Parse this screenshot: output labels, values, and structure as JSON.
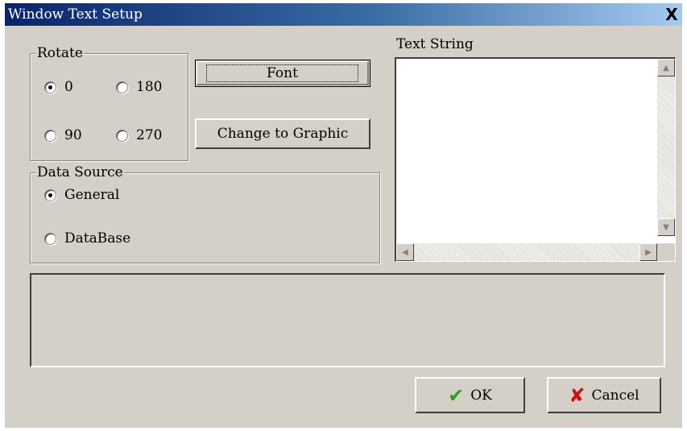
{
  "window": {
    "title": "Window Text Setup",
    "close_symbol": "X"
  },
  "rotate": {
    "legend": "Rotate",
    "options": [
      {
        "label": "0",
        "selected": true
      },
      {
        "label": "180",
        "selected": false
      },
      {
        "label": "90",
        "selected": false
      },
      {
        "label": "270",
        "selected": false
      }
    ]
  },
  "buttons": {
    "font": "Font",
    "change_to_graphic": "Change to Graphic",
    "ok": "OK",
    "cancel": "Cancel",
    "ok_icon": "checkmark-icon",
    "cancel_icon": "x-mark-icon"
  },
  "data_source": {
    "legend": "Data Source",
    "options": [
      {
        "label": "General",
        "selected": true
      },
      {
        "label": "DataBase",
        "selected": false
      }
    ]
  },
  "text_string": {
    "label": "Text String",
    "value": ""
  },
  "colors": {
    "title_bar_start": "#0a246a",
    "title_bar_end": "#a6caf0",
    "dialog_face": "#d4d0c8",
    "ok_check": "#2e9e1a",
    "cancel_x": "#d01010"
  }
}
